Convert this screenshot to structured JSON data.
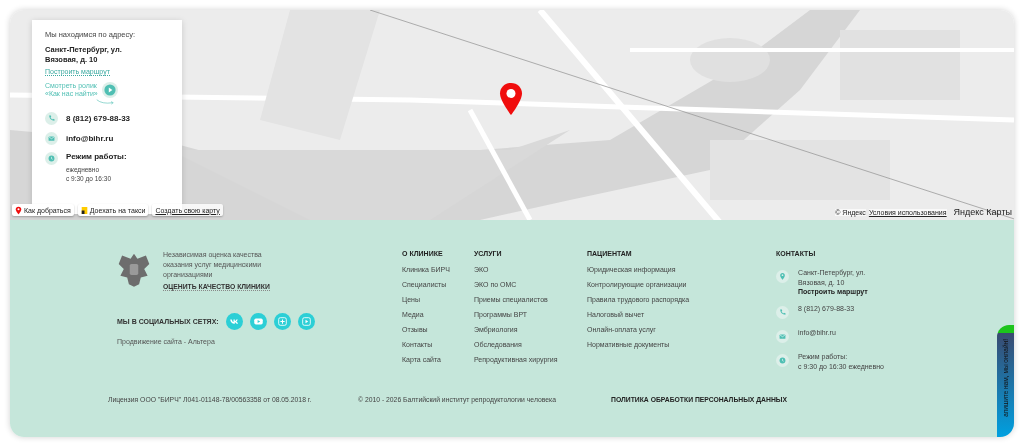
{
  "map": {
    "address_card": {
      "heading": "Мы находимся по адресу:",
      "address": "Санкт-Петербург, ул.\nВязовая, д. 10",
      "route_link": "Построить маршрут",
      "video_link": "Смотреть ролик\n«Как нас найти»",
      "phone": "8 (812) 679-88-33",
      "email": "info@bihr.ru",
      "hours_label": "Режим работы:",
      "hours": "ежедневно\nс 9:30 до 16:30"
    },
    "controls": [
      {
        "label": "Как добраться",
        "kind": "pin"
      },
      {
        "label": "Доехать на такси",
        "kind": "taxi"
      },
      {
        "label": "Создать свою карту",
        "kind": "plain"
      }
    ],
    "copyright": "© Яндекс",
    "terms": "Условия использования",
    "brand": "Яндекс Карты"
  },
  "footer": {
    "rating": {
      "text": "Независимая оценка качества оказания услуг медицинскими организациями",
      "link": "ОЦЕНИТЬ КАЧЕСТВО КЛИНИКИ"
    },
    "social": {
      "label": "МЫ В СОЦИАЛЬНЫХ СЕТЯХ:",
      "icons": [
        {
          "kind": "vk"
        },
        {
          "kind": "video"
        },
        {
          "kind": "plus"
        },
        {
          "kind": "play"
        }
      ]
    },
    "promo": "Продвижение сайта - Альтера",
    "columns": [
      {
        "title": "О КЛИНИКЕ",
        "items": [
          "Клиника БИРЧ",
          "Специалисты",
          "Цены",
          "Медиа",
          "Отзывы",
          "Контакты",
          "Карта сайта"
        ]
      },
      {
        "title": "УСЛУГИ",
        "items": [
          "ЭКО",
          "ЭКО по ОМС",
          "Приемы специалистов",
          "Программы ВРТ",
          "Эмбриология",
          "Обследования",
          "Репродуктивная хирургия"
        ]
      },
      {
        "title": "ПАЦИЕНТАМ",
        "items": [
          "Юридическая информация",
          "Контролирующие организации",
          "Правила трудового распорядка",
          "Налоговый вычет",
          "Онлайн-оплата услуг",
          "Нормативные документы"
        ]
      }
    ],
    "contacts": {
      "title": "КОНТАКТЫ",
      "items": [
        {
          "kind": "address",
          "text": "Санкт-Петербург, ул.\nВязовая, д. 10",
          "link": "Построить маршрут"
        },
        {
          "kind": "phone",
          "text": "8 (812) 679-88-33"
        },
        {
          "kind": "email",
          "text": "info@bihr.ru"
        },
        {
          "kind": "hours",
          "text": "Режим работы:\nс 9:30 до 16:30 ежедневно"
        }
      ]
    },
    "license": "Лицензия ООО \"БИРЧ\" Л041-01148-78/00563358 от 08.05.2018 г.",
    "copyright": "© 2010 - 2026 Балтийский институт репродуктологии человека",
    "policy": "ПОЛИТИКА ОБРАБОТКИ ПЕРСОНАЛЬНЫХ ДАННЫХ"
  },
  "chat_widget": {
    "label": "апишите нам, мы онлайн!"
  }
}
